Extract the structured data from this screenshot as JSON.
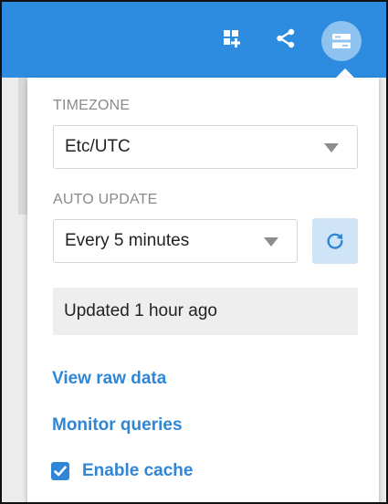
{
  "toolbar": {
    "add_icon": "add-widget-icon",
    "share_icon": "share-icon",
    "settings_icon": "settings-panel-icon"
  },
  "panel": {
    "timezone_label": "TIMEZONE",
    "timezone_value": "Etc/UTC",
    "auto_update_label": "AUTO UPDATE",
    "auto_update_value": "Every 5 minutes",
    "status_text": "Updated 1 hour ago",
    "view_raw_data_link": "View raw data",
    "monitor_queries_link": "Monitor queries",
    "enable_cache_label": "Enable cache",
    "enable_cache_checked": true
  },
  "colors": {
    "topbar": "#2d8ce0",
    "accent": "#2f86d6",
    "refresh_bg": "#cfe4f7"
  }
}
